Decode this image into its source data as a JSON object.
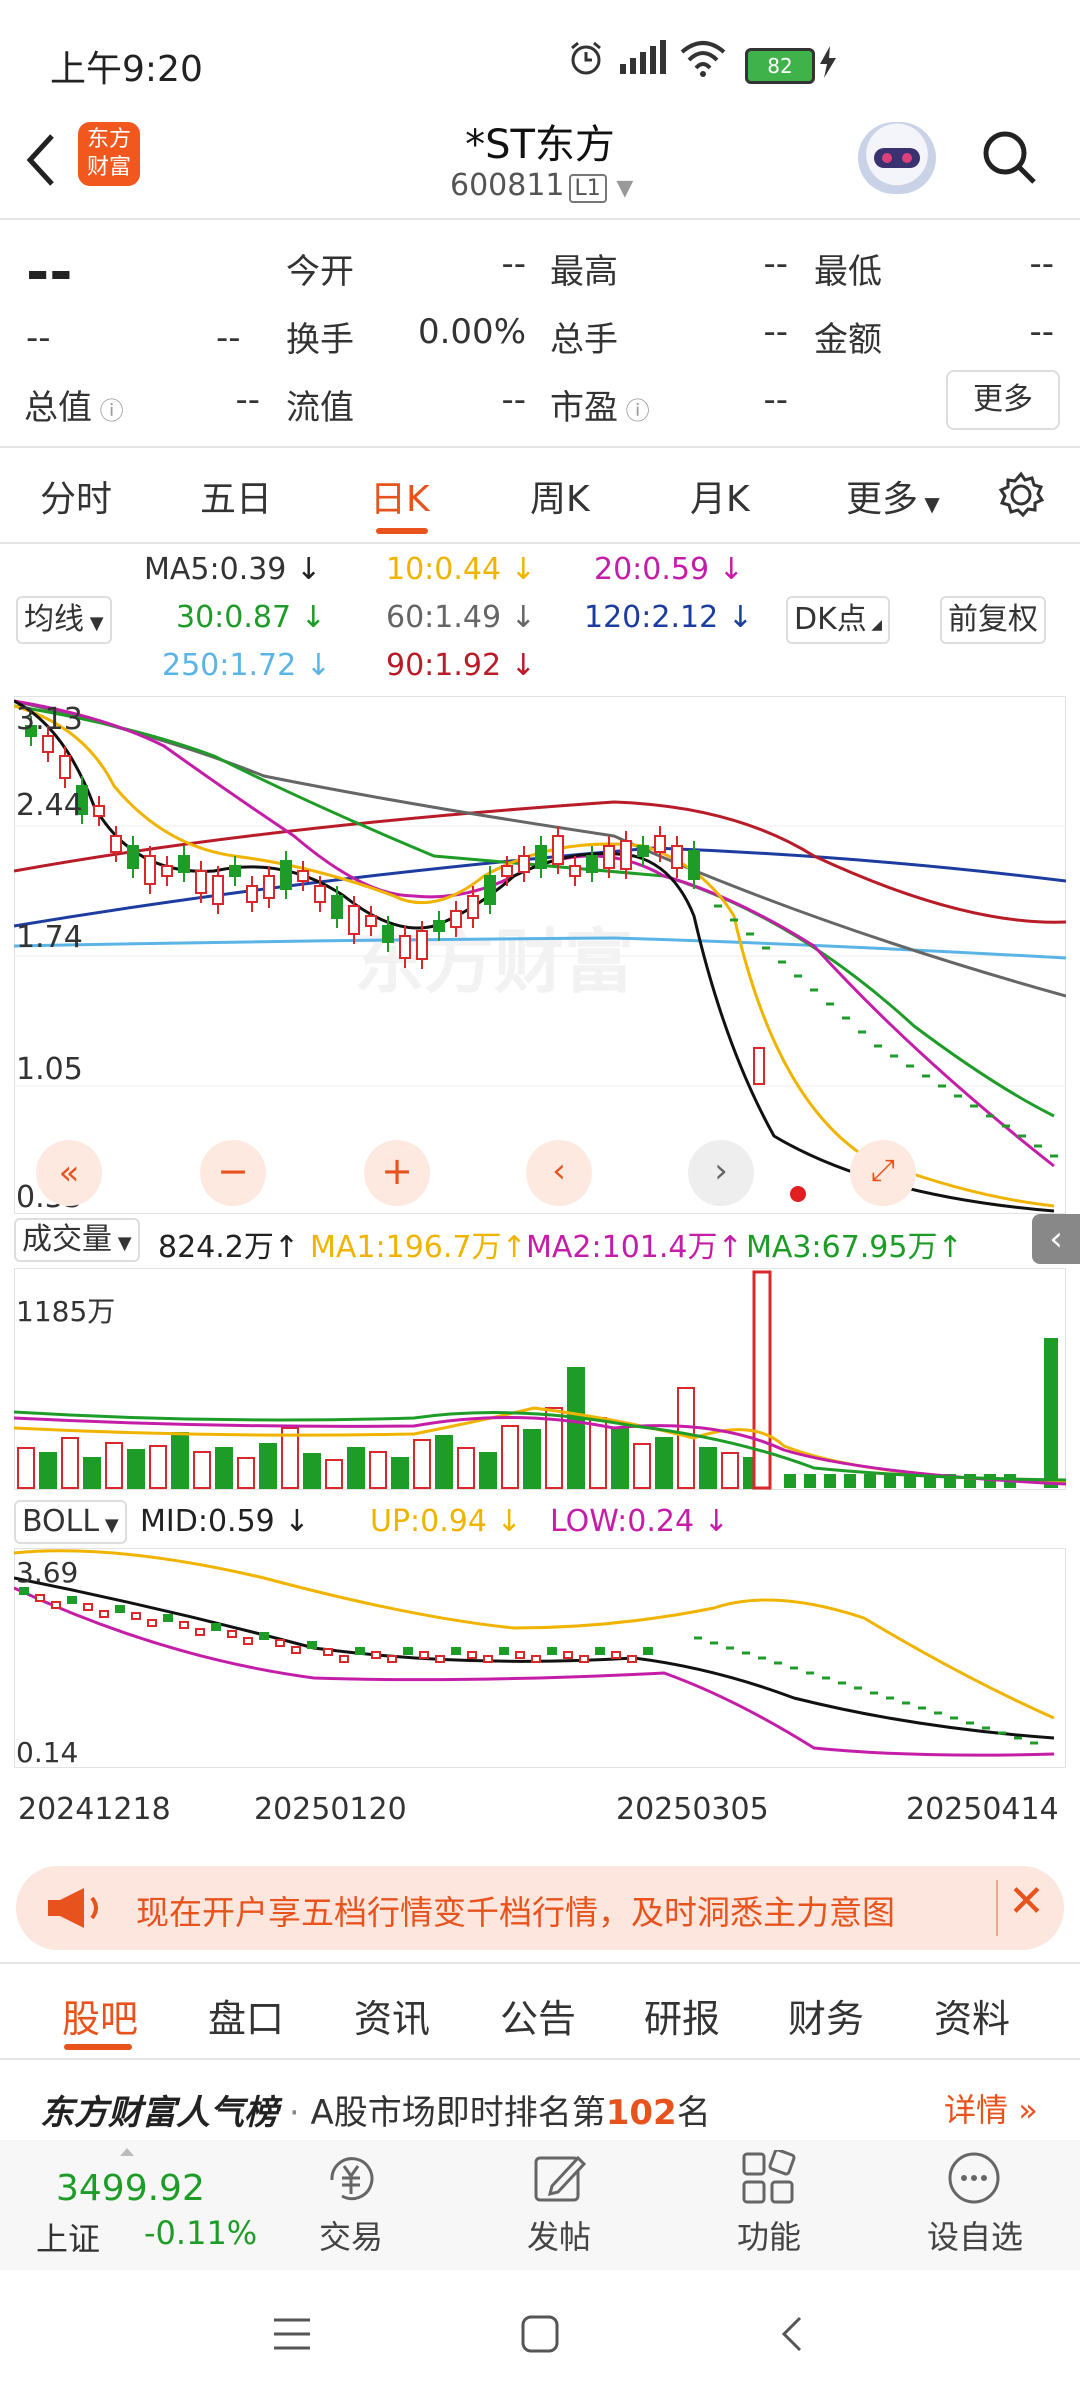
{
  "status_bar": {
    "time": "上午9:20",
    "battery": "82"
  },
  "header": {
    "title": "*ST东方",
    "code": "600811",
    "level": "L1",
    "logo_text": "东方财富"
  },
  "quote": {
    "price": "--",
    "change": "--",
    "change_pct": "--",
    "rows": [
      {
        "l1": "今开",
        "v1": "--",
        "l2": "最高",
        "v2": "--",
        "l3": "最低",
        "v3": "--"
      },
      {
        "l1": "换手",
        "v1": "0.00%",
        "l2": "总手",
        "v2": "--",
        "l3": "金额",
        "v3": "--"
      }
    ],
    "row3": {
      "l0": "总值",
      "v0": "--",
      "l1": "流值",
      "v1": "--",
      "l2": "市盈",
      "v2": "--"
    },
    "more": "更多"
  },
  "tabs": [
    "分时",
    "五日",
    "日K",
    "周K",
    "月K",
    "更多",
    "settings-gear"
  ],
  "active_tab": "日K",
  "ma_legend": {
    "chip": "均线",
    "items": [
      {
        "text": "MA5:0.39",
        "arrow": "↓",
        "color": "#333333"
      },
      {
        "text": "10:0.44",
        "arrow": "↓",
        "color": "#f0b400"
      },
      {
        "text": "20:0.59",
        "arrow": "↓",
        "color": "#c41ea8"
      },
      {
        "text": "30:0.87",
        "arrow": "↓",
        "color": "#1e9c28"
      },
      {
        "text": "60:1.49",
        "arrow": "↓",
        "color": "#666666"
      },
      {
        "text": "120:2.12",
        "arrow": "↓",
        "color": "#1c3ca0"
      },
      {
        "text": "250:1.72",
        "arrow": "↓",
        "color": "#5ab4e6"
      },
      {
        "text": "90:1.92",
        "arrow": "↓",
        "color": "#b81c28"
      }
    ],
    "dk": "DK点",
    "adjust": "前复权"
  },
  "price_axis": [
    "3.13",
    "2.44",
    "1.74",
    "1.05",
    "0.35"
  ],
  "chart_data": {
    "type": "candlestick",
    "x_dates": [
      "20241218",
      "20250120",
      "20250305",
      "20250414"
    ],
    "y_axis_price": [
      0.35,
      3.13
    ],
    "volume": {
      "label": "成交量",
      "value": "824.2万",
      "ma1": "MA1:196.7万",
      "ma2": "MA2:101.4万",
      "ma3": "MA3:67.95万",
      "max": "1185万"
    },
    "boll": {
      "label": "BOLL",
      "mid": "MID:0.59",
      "up": "UP:0.94",
      "low": "LOW:0.24",
      "axis_top": "3.69",
      "axis_bottom": "0.14"
    }
  },
  "watermark": "东方财富",
  "banner": {
    "text": "现在开户享五档行情变千档行情，及时洞悉主力意图"
  },
  "bottom_tabs": [
    "股吧",
    "盘口",
    "资讯",
    "公告",
    "研报",
    "财务",
    "资料"
  ],
  "rank": {
    "brand": "东方财富人气榜",
    "dot": "·",
    "prefix": "A股市场即时排名第",
    "num": "102",
    "suffix": "名",
    "link": "详情"
  },
  "index": {
    "value": "3499.92",
    "name": "上证",
    "change": "-0.11%"
  },
  "nav": [
    "交易",
    "发帖",
    "功能",
    "设自选"
  ]
}
